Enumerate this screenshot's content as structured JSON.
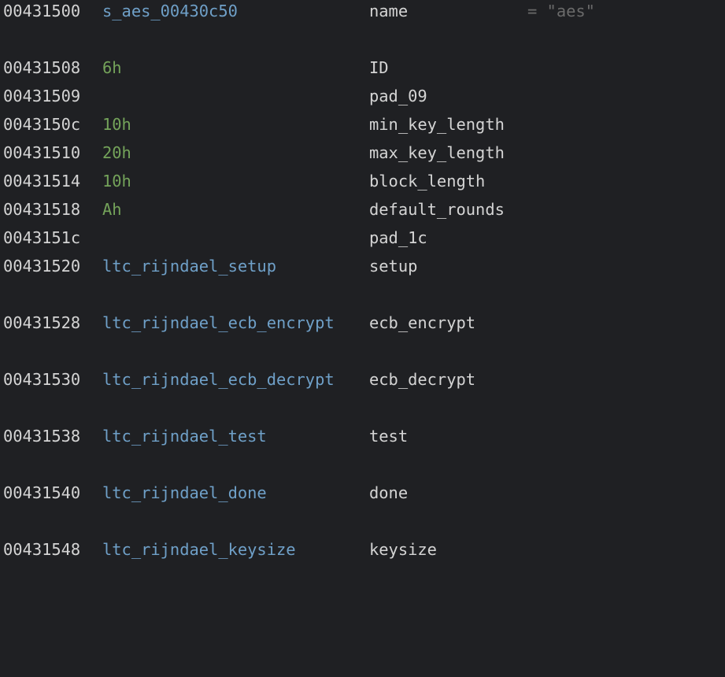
{
  "colors": {
    "background": "#1f2023",
    "address": "#d4d4d4",
    "symbol": "#6fa0c8",
    "number": "#74a35a",
    "field": "#d4d4d4",
    "comment": "#6a6a6a"
  },
  "rows": [
    {
      "address": "00431500",
      "value": "s_aes_00430c50",
      "value_kind": "sym",
      "field": "name",
      "comment": "= \"aes\""
    },
    {
      "address": "00431508",
      "value": "6h",
      "value_kind": "num",
      "field": "ID",
      "comment": ""
    },
    {
      "address": "00431509",
      "value": "",
      "value_kind": "none",
      "field": "pad_09",
      "comment": ""
    },
    {
      "address": "0043150c",
      "value": "10h",
      "value_kind": "num",
      "field": "min_key_length",
      "comment": ""
    },
    {
      "address": "00431510",
      "value": "20h",
      "value_kind": "num",
      "field": "max_key_length",
      "comment": ""
    },
    {
      "address": "00431514",
      "value": "10h",
      "value_kind": "num",
      "field": "block_length",
      "comment": ""
    },
    {
      "address": "00431518",
      "value": "Ah",
      "value_kind": "num",
      "field": "default_rounds",
      "comment": ""
    },
    {
      "address": "0043151c",
      "value": "",
      "value_kind": "none",
      "field": "pad_1c",
      "comment": ""
    },
    {
      "address": "00431520",
      "value": "ltc_rijndael_setup",
      "value_kind": "sym",
      "field": "setup",
      "comment": ""
    },
    {
      "address": "00431528",
      "value": "ltc_rijndael_ecb_encrypt",
      "value_kind": "sym",
      "field": "ecb_encrypt",
      "comment": ""
    },
    {
      "address": "00431530",
      "value": "ltc_rijndael_ecb_decrypt",
      "value_kind": "sym",
      "field": "ecb_decrypt",
      "comment": ""
    },
    {
      "address": "00431538",
      "value": "ltc_rijndael_test",
      "value_kind": "sym",
      "field": "test",
      "comment": ""
    },
    {
      "address": "00431540",
      "value": "ltc_rijndael_done",
      "value_kind": "sym",
      "field": "done",
      "comment": ""
    },
    {
      "address": "00431548",
      "value": "ltc_rijndael_keysize",
      "value_kind": "sym",
      "field": "keysize",
      "comment": ""
    }
  ]
}
